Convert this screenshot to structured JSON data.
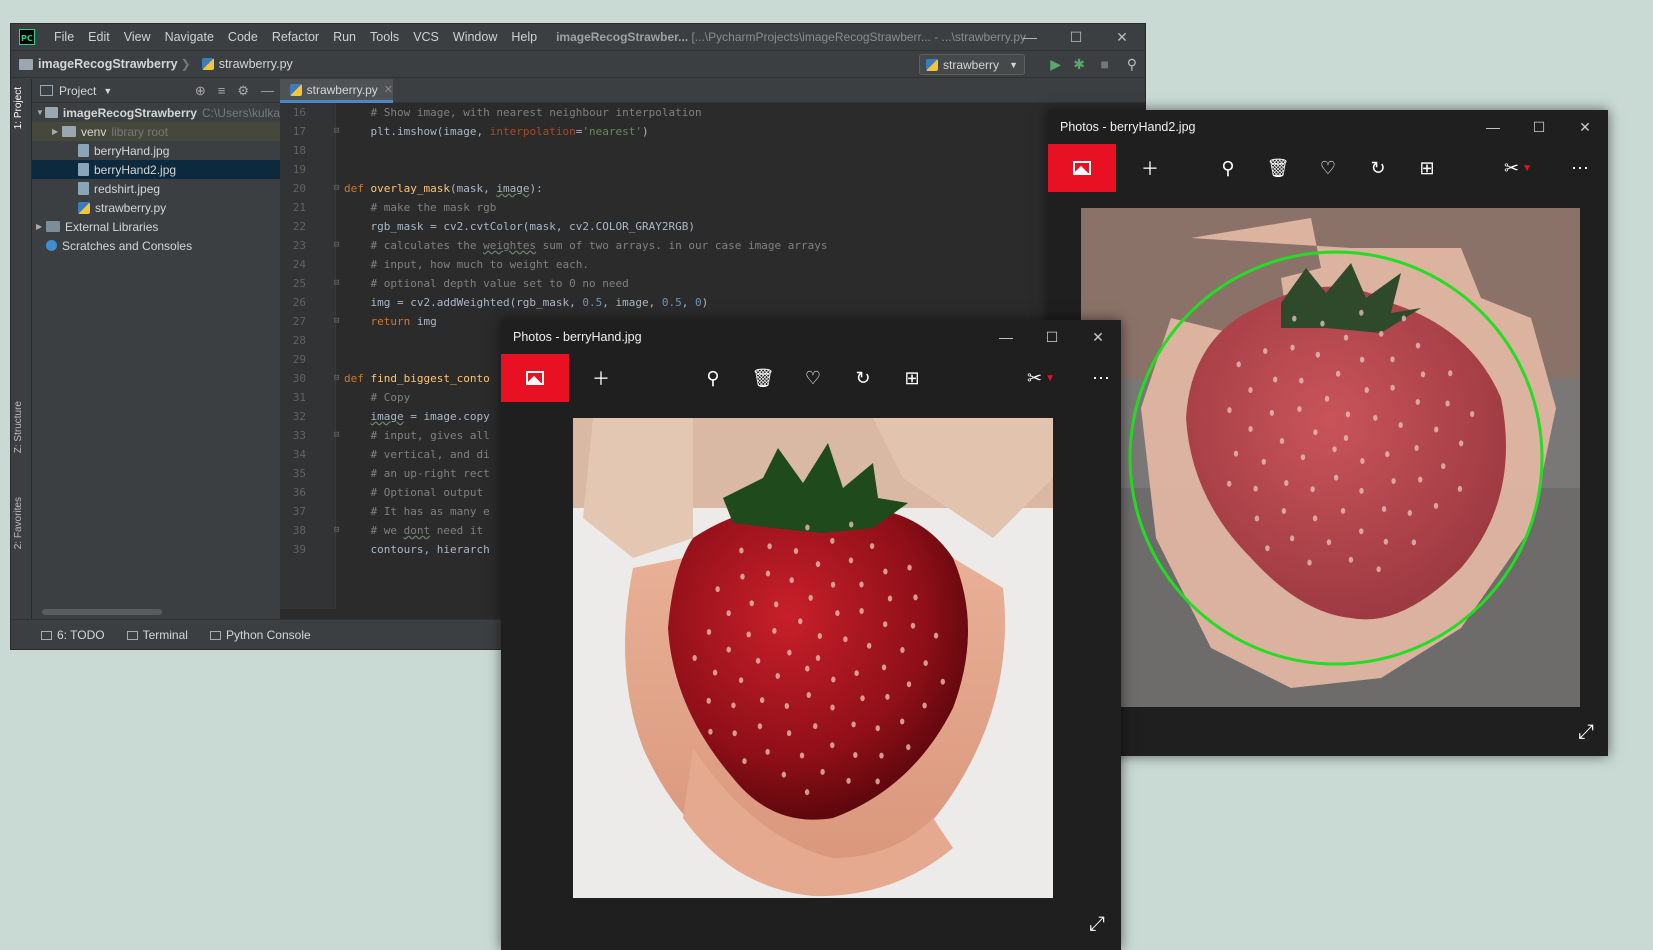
{
  "ide": {
    "menu": [
      "File",
      "Edit",
      "View",
      "Navigate",
      "Code",
      "Refactor",
      "Run",
      "Tools",
      "VCS",
      "Window",
      "Help"
    ],
    "title_project": "imageRecogStrawber...",
    "title_path": "[...\\PycharmProjects\\imageRecogStrawberr... - ...\\strawberry.py",
    "breadcrumb_project": "imageRecogStrawberry",
    "breadcrumb_file": "strawberry.py",
    "run_config": "strawberry",
    "left_tabs": {
      "project": "1: Project",
      "structure": "Z: Structure",
      "favorites": "2: Favorites"
    },
    "project_panel": {
      "header": "Project",
      "tree": [
        {
          "label": "imageRecogStrawberry",
          "extra": "C:\\Users\\kulka",
          "kind": "folder",
          "indent": 0,
          "expanded": true,
          "bold": true
        },
        {
          "label": "venv",
          "extra": "library root",
          "kind": "folder",
          "indent": 1,
          "expanded": false,
          "highlight": "lib"
        },
        {
          "label": "berryHand.jpg",
          "extra": "",
          "kind": "file",
          "indent": 2
        },
        {
          "label": "berryHand2.jpg",
          "extra": "",
          "kind": "file",
          "indent": 2,
          "highlight": "sel"
        },
        {
          "label": "redshirt.jpeg",
          "extra": "",
          "kind": "file",
          "indent": 2
        },
        {
          "label": "strawberry.py",
          "extra": "",
          "kind": "py",
          "indent": 2
        },
        {
          "label": "External Libraries",
          "extra": "",
          "kind": "lib",
          "indent": 0,
          "expanded": false
        },
        {
          "label": "Scratches and Consoles",
          "extra": "",
          "kind": "scratch",
          "indent": 0
        }
      ]
    },
    "editor_tab": "strawberry.py",
    "code_lines": [
      {
        "n": "16",
        "html": "<span class='c-com'>    # Show image, with nearest neighbour interpolation</span>"
      },
      {
        "n": "17",
        "html": "    plt.imshow(image, <span class='c-param'>interpolation</span>=<span class='c-str'>'nearest'</span>)"
      },
      {
        "n": "18",
        "html": ""
      },
      {
        "n": "19",
        "html": ""
      },
      {
        "n": "20",
        "html": "<span class='c-kw'>def</span> <span class='c-fn'>overlay_mask</span>(mask, <span class='ul'>image</span>):"
      },
      {
        "n": "21",
        "html": "<span class='c-com'>    # make the mask rgb</span>"
      },
      {
        "n": "22",
        "html": "    rgb_mask = cv2.cvtColor(mask, cv2.COLOR_GRAY2RGB)"
      },
      {
        "n": "23",
        "html": "<span class='c-com'>    # calculates the <span class='ul'>weightes</span> sum of two arrays. in our case image arrays</span>"
      },
      {
        "n": "24",
        "html": "<span class='c-com'>    # input, how much to weight each.</span>"
      },
      {
        "n": "25",
        "html": "<span class='c-com'>    # optional depth value set to 0 no need</span>"
      },
      {
        "n": "26",
        "html": "    img = cv2.addWeighted(rgb_mask, <span class='c-num'>0.5</span>, image, <span class='c-num'>0.5</span>, <span class='c-num'>0</span>)"
      },
      {
        "n": "27",
        "html": "    <span class='c-kw'>return</span> img"
      },
      {
        "n": "28",
        "html": ""
      },
      {
        "n": "29",
        "html": ""
      },
      {
        "n": "30",
        "html": "<span class='c-kw'>def</span> <span class='c-fn'>find_biggest_conto</span>"
      },
      {
        "n": "31",
        "html": "<span class='c-com'>    # Copy</span>"
      },
      {
        "n": "32",
        "html": "    <span class='ul'>image</span> = image.copy"
      },
      {
        "n": "33",
        "html": "<span class='c-com'>    # input, gives all</span>"
      },
      {
        "n": "34",
        "html": "<span class='c-com'>    # vertical, and di</span>"
      },
      {
        "n": "35",
        "html": "<span class='c-com'>    # an up-right rect</span>"
      },
      {
        "n": "36",
        "html": "<span class='c-com'>    # Optional output</span>"
      },
      {
        "n": "37",
        "html": "<span class='c-com'>    # It has as many e</span>"
      },
      {
        "n": "38",
        "html": "<span class='c-com'>    # we <span class='ul'>dont</span> need it</span>"
      },
      {
        "n": "39",
        "html": "    contours, hierarch"
      }
    ],
    "bottom_tabs": [
      "6: TODO",
      "Terminal",
      "Python Console"
    ]
  },
  "photos_back": {
    "title": "Photos - berryHand2.jpg"
  },
  "photos_front": {
    "title": "Photos - berryHand.jpg"
  },
  "colors": {
    "accent": "#e81123",
    "contour": "#22dd22"
  }
}
